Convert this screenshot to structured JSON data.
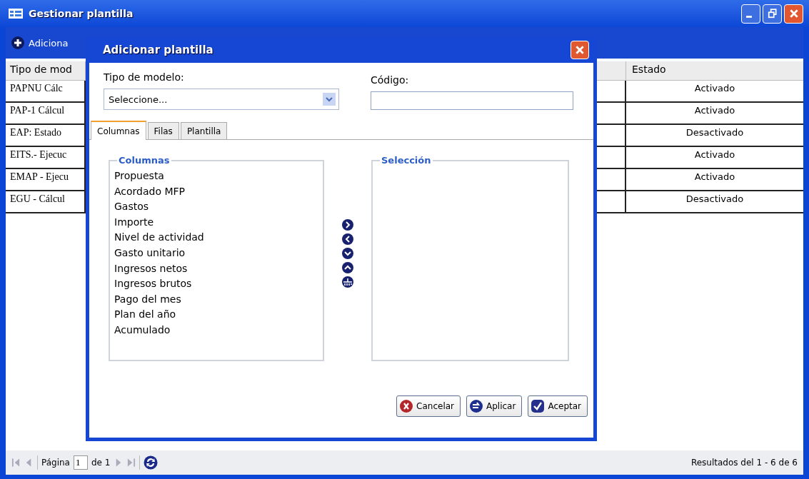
{
  "window": {
    "title": "Gestionar plantilla"
  },
  "toolbar": {
    "add_label": "Adiciona"
  },
  "table": {
    "columns": [
      "Tipo de mod",
      "Estado"
    ],
    "rows": [
      {
        "tipo": "PAPNU Cálc",
        "estado": "Activado"
      },
      {
        "tipo": "PAP-1 Cálcul",
        "estado": "Activado"
      },
      {
        "tipo": "EAP: Estado",
        "estado": "Desactivado"
      },
      {
        "tipo": "EITS.- Ejecuc",
        "estado": "Activado"
      },
      {
        "tipo": "EMAP - Ejecu",
        "estado": "Activado"
      },
      {
        "tipo": "EGU - Cálcul",
        "estado": "Desactivado"
      }
    ]
  },
  "dialog": {
    "title": "Adicionar plantilla",
    "tipo_label": "Tipo de modelo:",
    "tipo_value": "Seleccione...",
    "codigo_label": "Código:",
    "tabs": [
      {
        "label": "Columnas",
        "selected": true
      },
      {
        "label": "Filas",
        "selected": false
      },
      {
        "label": "Plantilla",
        "selected": false
      }
    ],
    "available": {
      "legend": "Columnas",
      "items": [
        "Propuesta",
        "Acordado MFP",
        "Gastos",
        "Importe",
        "Nivel de actividad",
        "Gasto unitario",
        "Ingresos netos",
        "Ingresos brutos",
        "Pago del mes",
        "Plan del año",
        "Acumulado"
      ]
    },
    "selection": {
      "legend": "Selección"
    },
    "buttons": [
      {
        "kind": "cancel",
        "label": "Cancelar"
      },
      {
        "kind": "apply",
        "label": "Aplicar"
      },
      {
        "kind": "accept",
        "label": "Aceptar"
      }
    ]
  },
  "pager": {
    "page_label": "Página",
    "page": "1",
    "of_label": "de 1",
    "summary": "Resultados del 1 - 6 de 6"
  }
}
